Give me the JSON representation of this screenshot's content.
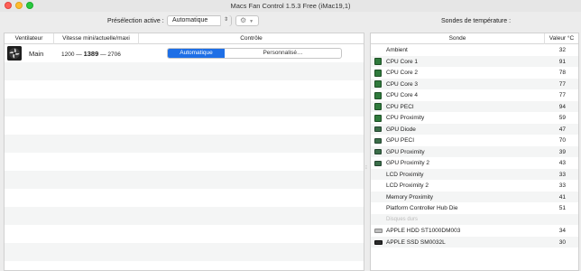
{
  "window": {
    "title": "Macs Fan Control 1.5.3 Free (iMac19,1)"
  },
  "toolbar": {
    "preset_label": "Présélection active :",
    "preset_value": "Automatique",
    "sensors_title": "Sondes de température :"
  },
  "fans_table": {
    "columns": [
      "Ventilateur",
      "Vitesse mini/actuelle/maxi",
      "Contrôle"
    ],
    "rows": [
      {
        "name": "Main",
        "min": "1200",
        "current": "1389",
        "max": "2706",
        "separator": "—",
        "control_auto": "Automatique",
        "control_custom": "Personnalisé…"
      }
    ]
  },
  "sensors_table": {
    "columns": [
      "Sonde",
      "Valeur °C"
    ],
    "rows": [
      {
        "icon": "",
        "name": "Ambient",
        "value": "32"
      },
      {
        "icon": "cpu-chip-icon",
        "name": "CPU Core 1",
        "value": "91"
      },
      {
        "icon": "cpu-chip-icon",
        "name": "CPU Core 2",
        "value": "78"
      },
      {
        "icon": "cpu-chip-icon",
        "name": "CPU Core 3",
        "value": "77"
      },
      {
        "icon": "cpu-chip-icon",
        "name": "CPU Core 4",
        "value": "77"
      },
      {
        "icon": "cpu-chip-icon",
        "name": "CPU PECI",
        "value": "94"
      },
      {
        "icon": "cpu-chip-icon",
        "name": "CPU Proximity",
        "value": "59"
      },
      {
        "icon": "gpu-card-icon",
        "name": "GPU Diode",
        "value": "47"
      },
      {
        "icon": "gpu-card-icon",
        "name": "GPU PECI",
        "value": "70"
      },
      {
        "icon": "gpu-card-icon",
        "name": "GPU Proximity",
        "value": "39"
      },
      {
        "icon": "gpu-card-icon",
        "name": "GPU Proximity 2",
        "value": "43"
      },
      {
        "icon": "",
        "name": "LCD Proximity",
        "value": "33"
      },
      {
        "icon": "",
        "name": "LCD Proximity 2",
        "value": "33"
      },
      {
        "icon": "",
        "name": "Memory Proximity",
        "value": "41"
      },
      {
        "icon": "",
        "name": "Platform Controller Hub Die",
        "value": "51"
      },
      {
        "icon": "",
        "name": "Disques durs",
        "value": "",
        "group": true
      },
      {
        "icon": "hdd-icon",
        "name": "APPLE HDD ST1000DM003",
        "value": "34"
      },
      {
        "icon": "ssd-icon",
        "name": "APPLE SSD SM0032L",
        "value": "30"
      }
    ]
  }
}
